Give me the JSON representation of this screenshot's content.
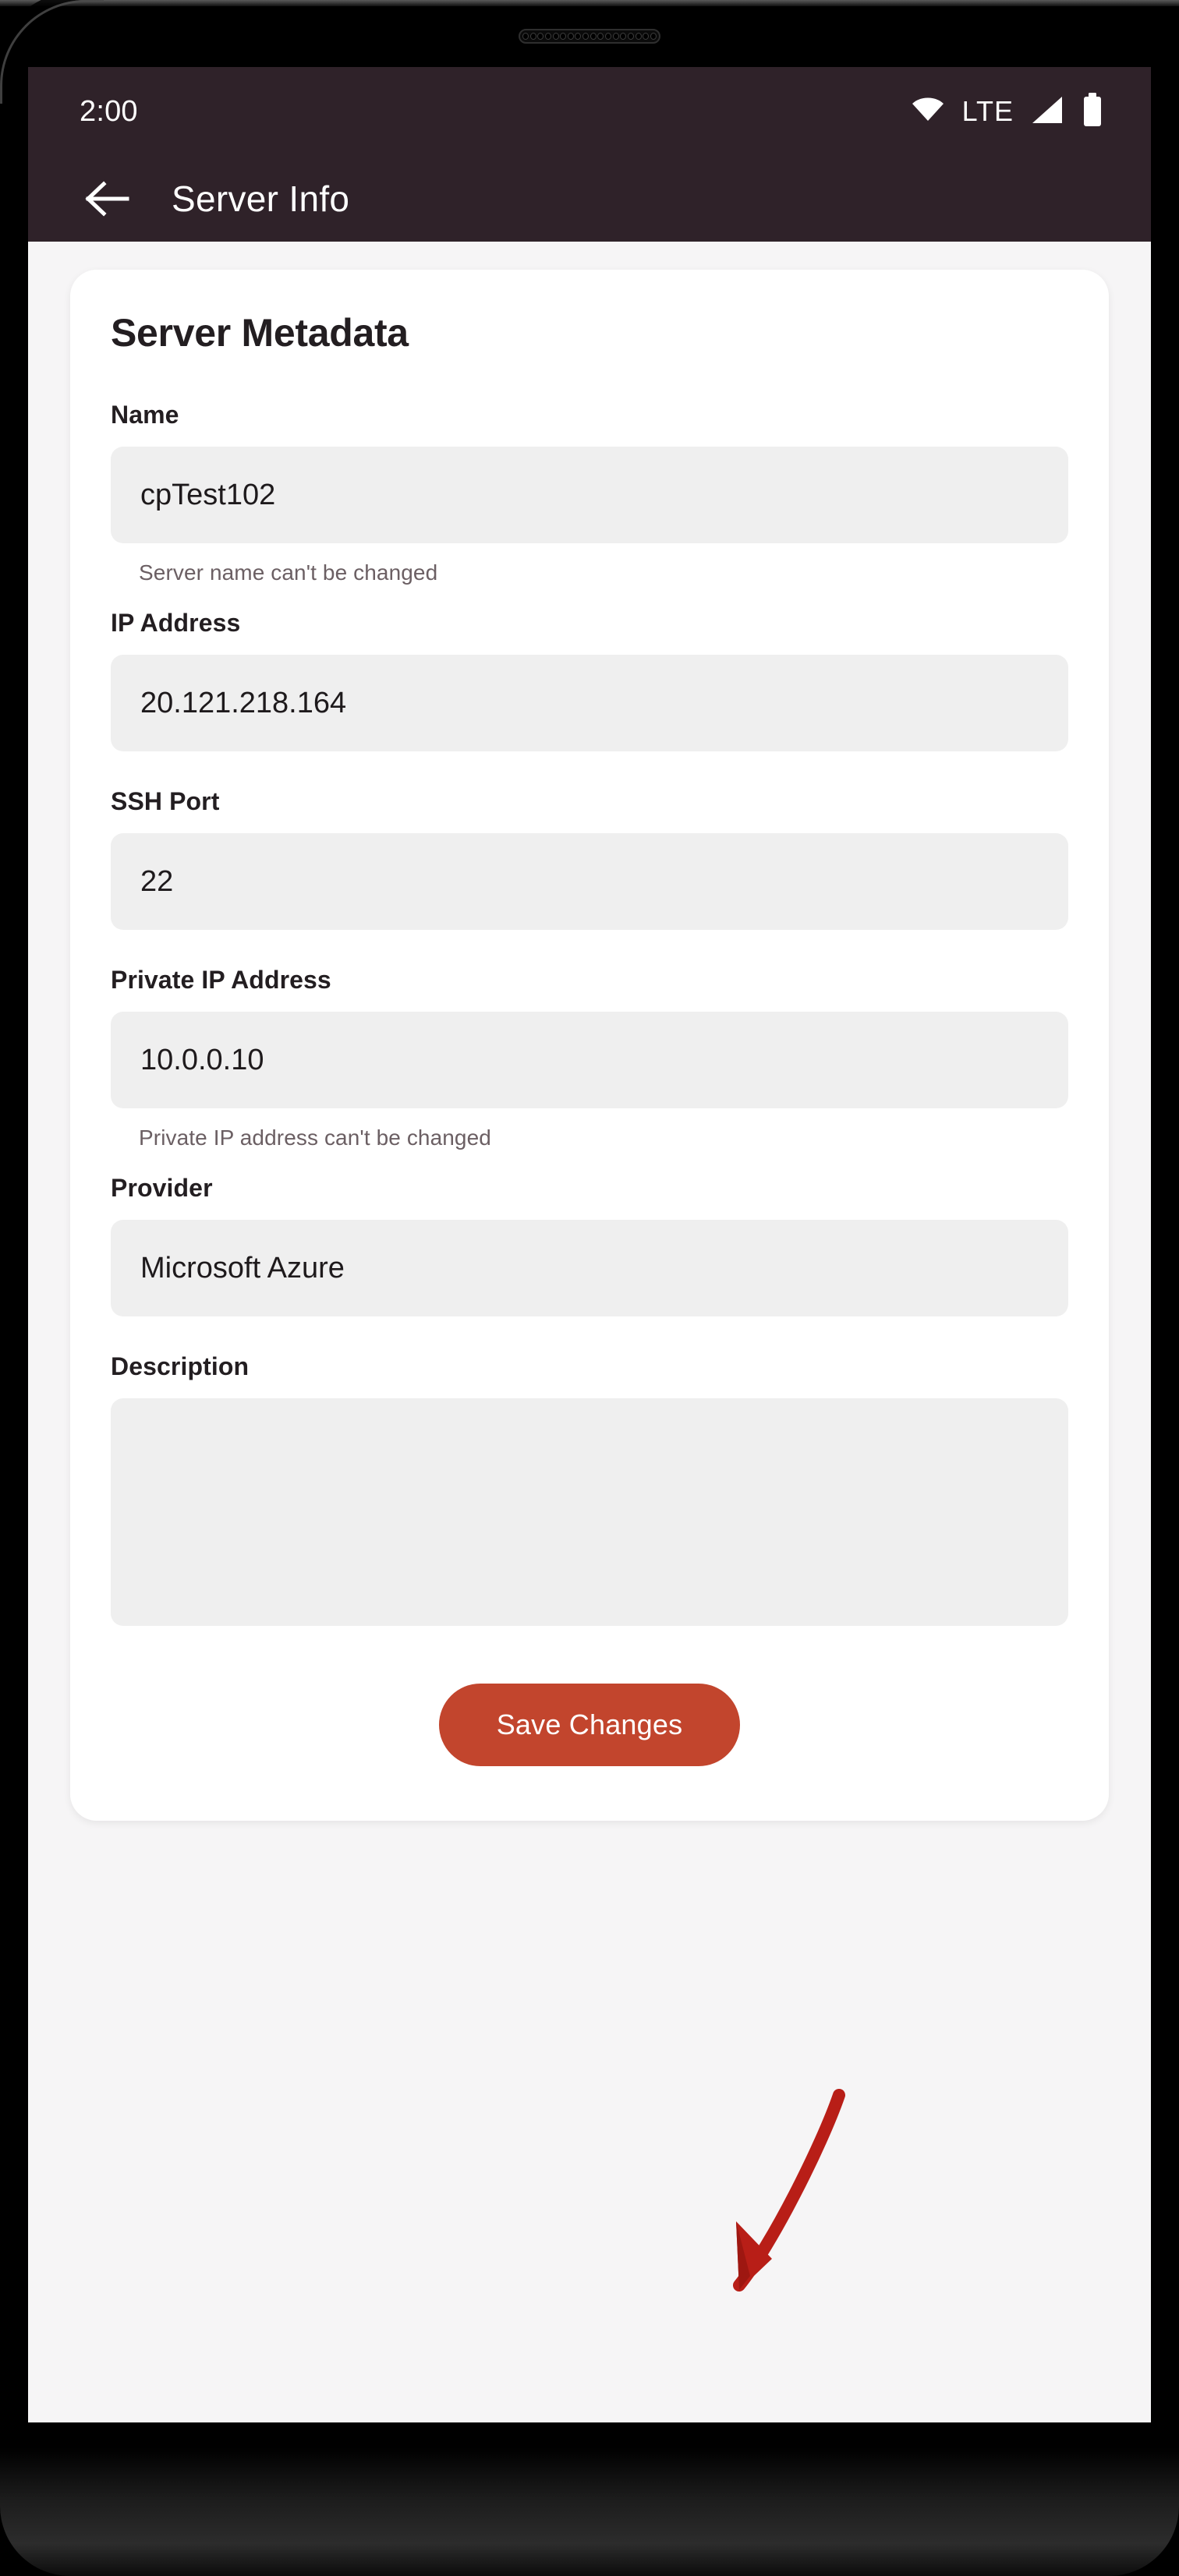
{
  "status_bar": {
    "time": "2:00",
    "network_label": "LTE",
    "icons": [
      "wifi-icon",
      "signal-icon",
      "battery-icon"
    ]
  },
  "app_bar": {
    "back_icon": "back-arrow-icon",
    "title": "Server Info"
  },
  "card": {
    "title": "Server Metadata",
    "fields": [
      {
        "label": "Name",
        "value": "cpTest102",
        "placeholder": "",
        "helper": "Server name can't be changed",
        "type": "text"
      },
      {
        "label": "IP Address",
        "value": "20.121.218.164",
        "placeholder": "",
        "helper": "",
        "type": "text"
      },
      {
        "label": "SSH Port",
        "value": "22",
        "placeholder": "",
        "helper": "",
        "type": "text"
      },
      {
        "label": "Private IP Address",
        "value": "10.0.0.10",
        "placeholder": "",
        "helper": "Private IP address can't be changed",
        "type": "text"
      },
      {
        "label": "Provider",
        "value": "Microsoft Azure",
        "placeholder": "",
        "helper": "",
        "type": "text"
      },
      {
        "label": "Description",
        "value": "",
        "placeholder": "",
        "helper": "",
        "type": "textarea"
      }
    ],
    "save_label": "Save Changes"
  },
  "annotation": {
    "type": "arrow",
    "target": "save-changes-button",
    "color": "#B81E17"
  },
  "colors": {
    "app_bar": "#2F2229",
    "page_background": "#F6F5F6",
    "card_background": "#FFFFFF",
    "input_background": "#EFEFEF",
    "accent": "#C2452D",
    "text_primary": "#231E21",
    "text_helper": "#6B5F63"
  },
  "system": {
    "home_indicator": "home-indicator"
  }
}
